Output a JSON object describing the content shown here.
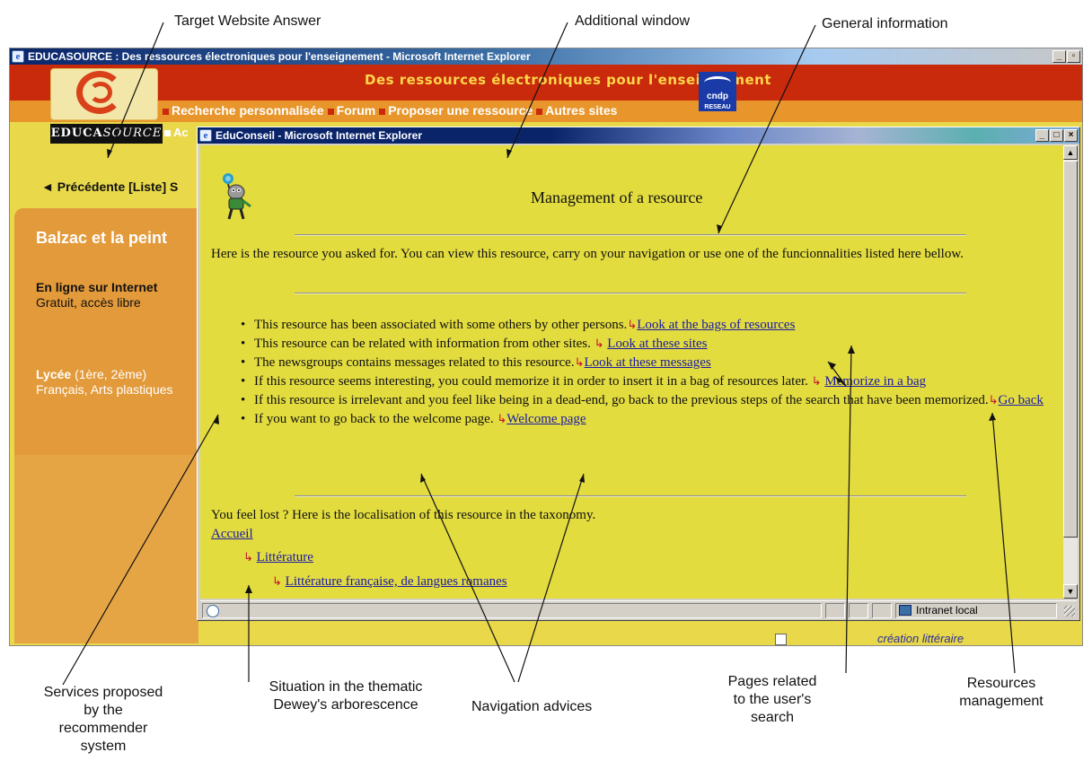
{
  "annotations": {
    "target_website_answer": "Target Website Answer",
    "additional_window": "Additional window",
    "general_information": "General information",
    "services_line1": "Services proposed",
    "services_line2": "by the",
    "services_line3": "recommender",
    "services_line4": "system",
    "situation_line1": "Situation in the thematic",
    "situation_line2": "Dewey's arborescence",
    "navigation_advices": "Navigation advices",
    "pages_line1": "Pages related",
    "pages_line2": "to the user's",
    "pages_line3": "search",
    "resources_line1": "Resources",
    "resources_line2": "management"
  },
  "outer_window": {
    "title": "EDUCASOURCE : Des ressources électroniques pour l'enseignement - Microsoft Internet Explorer",
    "tagline": "Des ressources électroniques pour l'enseignement",
    "nav_items": [
      "Recherche personnalisée",
      "Forum",
      "Proposer une ressource",
      "Autres sites"
    ],
    "wordmark_upright": "EDUCA",
    "wordmark_italic": "SOURCE",
    "tab_accueil": "Ac",
    "cndp_label": "cndp",
    "cndp_sub": "RESEAU",
    "prev_link": "◄ Précédente [Liste] S",
    "side_title": "Balzac et la peint",
    "online": "En ligne sur Internet",
    "free": "Gratuit, accès libre",
    "level_bold": "Lycée",
    "level_rest": " (1ère, 2ème)",
    "subjects": "Français, Arts plastiques",
    "footer_creation": "création littéraire"
  },
  "popup": {
    "title": "EduConseil - Microsoft Internet Explorer",
    "heading": "Management of a resource",
    "intro": "Here is the resource you asked for. You can view this resource, carry on your navigation or use one of the funcionnalities listed here bellow.",
    "services": [
      {
        "text": "This resource has been associated with some others by other persons.",
        "link": "Look at the bags of resources"
      },
      {
        "text": "This resource can be related with information from other sites.",
        "link": "Look at these sites"
      },
      {
        "text": "The newsgroups contains messages related to this resource.",
        "link": "Look at these messages"
      },
      {
        "text": "If this resource seems interesting, you could memorize it in order to insert it in a bag of resources later.",
        "link": "Memorize in a bag"
      },
      {
        "text": "If this resource is irrelevant and you feel like being in a dead-end, go back to the previous steps of the search that have been memorized.",
        "link": "Go back"
      },
      {
        "text": "If you want to go back to the welcome page.",
        "link": "Welcome page"
      }
    ],
    "arrow_symbol": "↳",
    "lost_text": "You feel lost ? Here is the localisation of this resource in the taxonomy.",
    "taxonomy": [
      "Accueil",
      "Littérature",
      "Littérature française, de langues romanes"
    ],
    "status_zone": "Intranet local"
  },
  "colors": {
    "page_yellow": "#e3dc3f",
    "banner_red": "#c82a0b",
    "nav_orange": "#e8962c",
    "link_blue": "#1a1aa8",
    "arrow_red": "#c8102e"
  }
}
